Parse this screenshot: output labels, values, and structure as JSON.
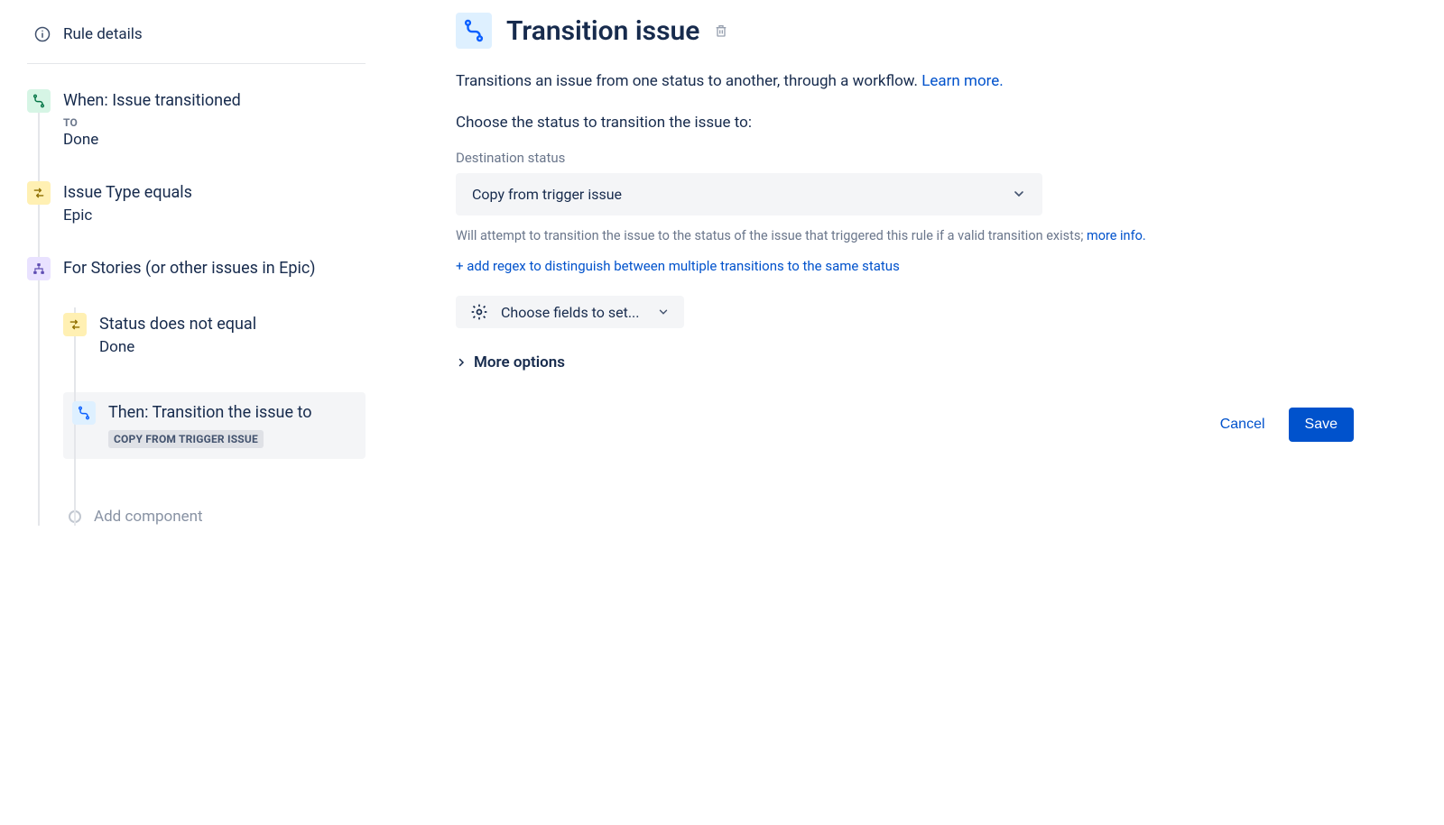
{
  "sidebar": {
    "rule_details_label": "Rule details",
    "steps": [
      {
        "title": "When: Issue transitioned",
        "sub_label": "TO",
        "value": "Done"
      },
      {
        "title": "Issue Type equals",
        "value": "Epic"
      },
      {
        "title": "For Stories (or other issues in Epic)"
      }
    ],
    "nested_steps": [
      {
        "title": "Status does not equal",
        "value": "Done"
      },
      {
        "title": "Then: Transition the issue to",
        "badge": "COPY FROM TRIGGER ISSUE"
      }
    ],
    "add_component_label": "Add component"
  },
  "main": {
    "title": "Transition issue",
    "description_text": "Transitions an issue from one status to another, through a workflow. ",
    "learn_more_label": "Learn more.",
    "choose_label": "Choose the status to transition the issue to:",
    "destination_label": "Destination status",
    "destination_value": "Copy from trigger issue",
    "help_text": "Will attempt to transition the issue to the status of the issue that triggered this rule if a valid transition exists; ",
    "more_info_label": "more info.",
    "regex_link": "+ add regex to distinguish between multiple transitions to the same status",
    "choose_fields_label": "Choose fields to set...",
    "more_options_label": "More options",
    "cancel_label": "Cancel",
    "save_label": "Save"
  }
}
